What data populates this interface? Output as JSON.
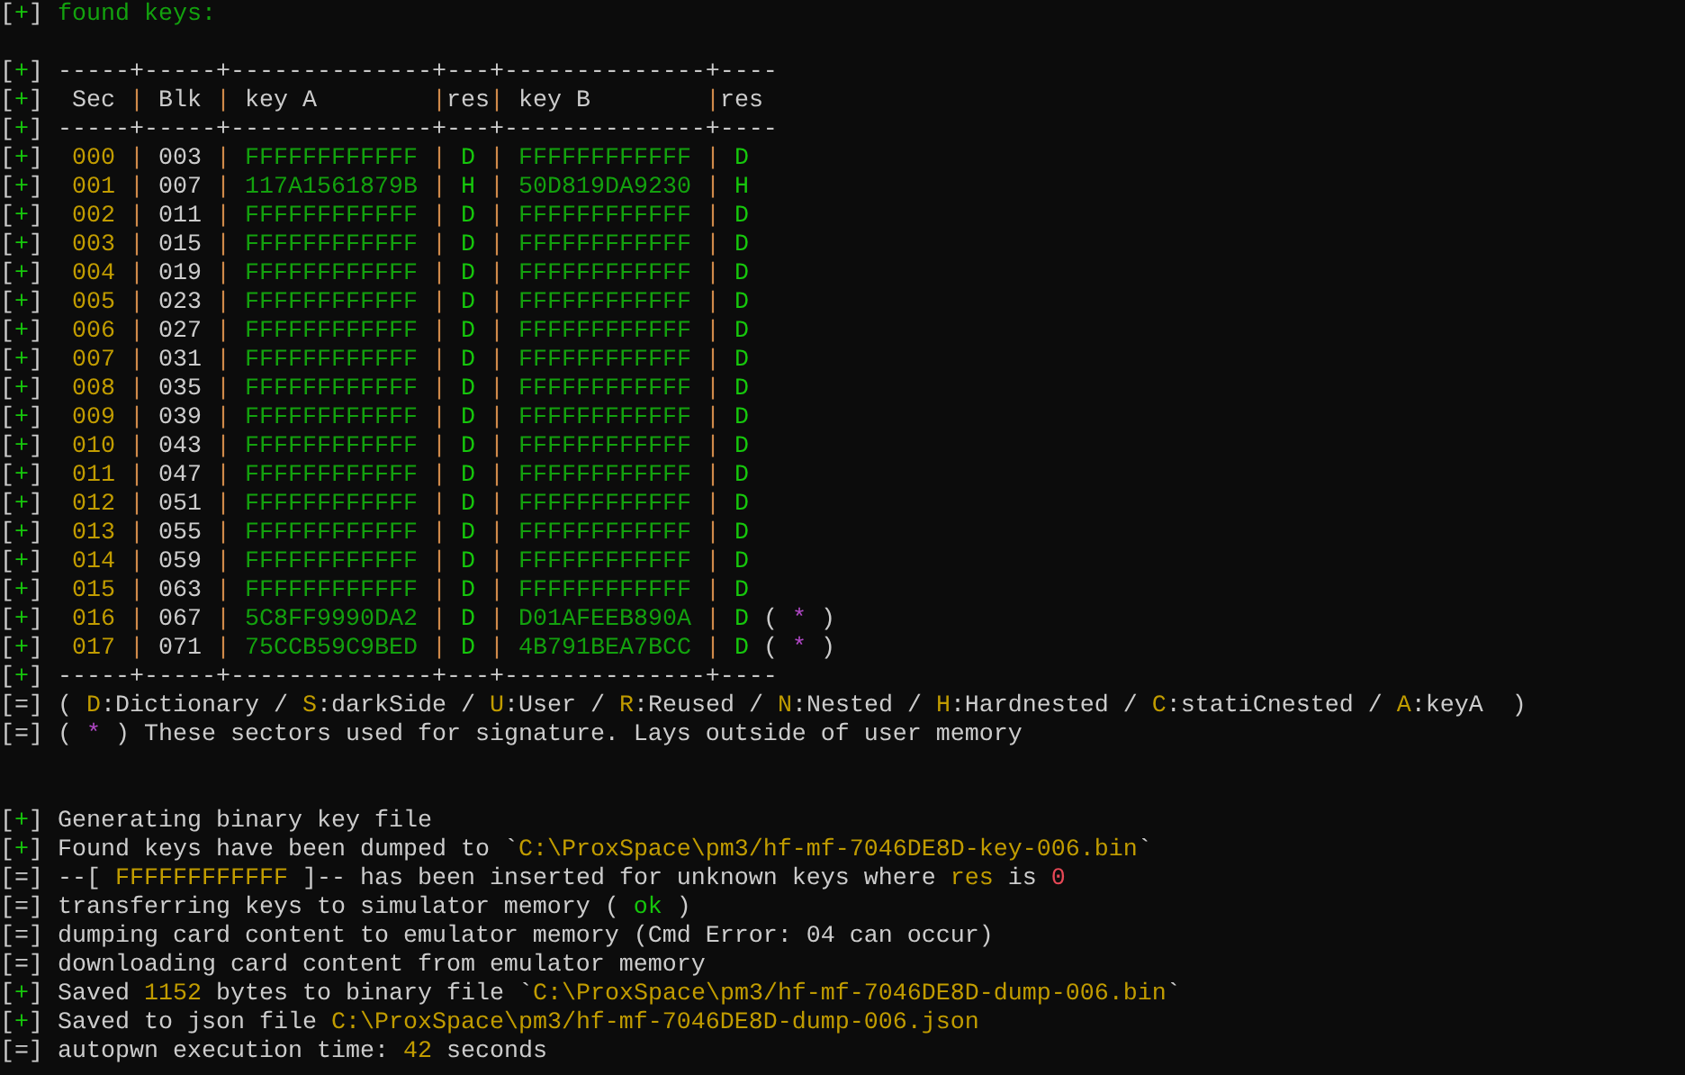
{
  "terminal": {
    "lines": [
      {
        "kind": "text",
        "segs": [
          {
            "text": "[",
            "kind": "plain"
          },
          {
            "text": "+",
            "kind": "ok"
          },
          {
            "text": "] ",
            "kind": "plain"
          },
          {
            "text": "found keys:",
            "kind": "key"
          }
        ]
      },
      {
        "kind": "blank"
      },
      {
        "kind": "text",
        "segs": [
          {
            "text": "[",
            "kind": "plain"
          },
          {
            "text": "+",
            "kind": "ok"
          },
          {
            "text": "] ",
            "kind": "plain"
          },
          {
            "text": "-----+-----+--------------+---+--------------+----",
            "kind": "plain"
          }
        ]
      },
      {
        "kind": "text",
        "segs": [
          {
            "text": "[",
            "kind": "plain"
          },
          {
            "text": "+",
            "kind": "ok"
          },
          {
            "text": "] ",
            "kind": "plain"
          },
          {
            "text": " Sec",
            "kind": "plain"
          },
          {
            "text": " | ",
            "kind": "sep"
          },
          {
            "text": "Blk",
            "kind": "plain"
          },
          {
            "text": " | ",
            "kind": "sep"
          },
          {
            "text": "key A",
            "kind": "plain"
          },
          {
            "text": "        |",
            "kind": "sep"
          },
          {
            "text": "res",
            "kind": "plain"
          },
          {
            "text": "| ",
            "kind": "sep"
          },
          {
            "text": "key B",
            "kind": "plain"
          },
          {
            "text": "        |",
            "kind": "sep"
          },
          {
            "text": "res",
            "kind": "plain"
          }
        ]
      },
      {
        "kind": "text",
        "segs": [
          {
            "text": "[",
            "kind": "plain"
          },
          {
            "text": "+",
            "kind": "ok"
          },
          {
            "text": "] ",
            "kind": "plain"
          },
          {
            "text": "-----+-----+--------------+---+--------------+----",
            "kind": "plain"
          }
        ]
      },
      {
        "kind": "text",
        "segs": [
          {
            "text": "[",
            "kind": "plain"
          },
          {
            "text": "+",
            "kind": "ok"
          },
          {
            "text": "] ",
            "kind": "plain"
          },
          {
            "text": " 000",
            "kind": "hi"
          },
          {
            "text": " | ",
            "kind": "sep"
          },
          {
            "text": "003",
            "kind": "plain"
          },
          {
            "text": " | ",
            "kind": "sep"
          },
          {
            "text": "FFFFFFFFFFFF",
            "kind": "key"
          },
          {
            "text": " | ",
            "kind": "sep"
          },
          {
            "text": "D",
            "kind": "ok"
          },
          {
            "text": " | ",
            "kind": "sep"
          },
          {
            "text": "FFFFFFFFFFFF",
            "kind": "key"
          },
          {
            "text": " | ",
            "kind": "sep"
          },
          {
            "text": "D",
            "kind": "ok"
          }
        ]
      },
      {
        "kind": "text",
        "segs": [
          {
            "text": "[",
            "kind": "plain"
          },
          {
            "text": "+",
            "kind": "ok"
          },
          {
            "text": "] ",
            "kind": "plain"
          },
          {
            "text": " 001",
            "kind": "hi"
          },
          {
            "text": " | ",
            "kind": "sep"
          },
          {
            "text": "007",
            "kind": "plain"
          },
          {
            "text": " | ",
            "kind": "sep"
          },
          {
            "text": "117A1561879B",
            "kind": "key"
          },
          {
            "text": " | ",
            "kind": "sep"
          },
          {
            "text": "H",
            "kind": "ok"
          },
          {
            "text": " | ",
            "kind": "sep"
          },
          {
            "text": "50D819DA9230",
            "kind": "key"
          },
          {
            "text": " | ",
            "kind": "sep"
          },
          {
            "text": "H",
            "kind": "ok"
          }
        ]
      },
      {
        "kind": "text",
        "segs": [
          {
            "text": "[",
            "kind": "plain"
          },
          {
            "text": "+",
            "kind": "ok"
          },
          {
            "text": "] ",
            "kind": "plain"
          },
          {
            "text": " 002",
            "kind": "hi"
          },
          {
            "text": " | ",
            "kind": "sep"
          },
          {
            "text": "011",
            "kind": "plain"
          },
          {
            "text": " | ",
            "kind": "sep"
          },
          {
            "text": "FFFFFFFFFFFF",
            "kind": "key"
          },
          {
            "text": " | ",
            "kind": "sep"
          },
          {
            "text": "D",
            "kind": "ok"
          },
          {
            "text": " | ",
            "kind": "sep"
          },
          {
            "text": "FFFFFFFFFFFF",
            "kind": "key"
          },
          {
            "text": " | ",
            "kind": "sep"
          },
          {
            "text": "D",
            "kind": "ok"
          }
        ]
      },
      {
        "kind": "text",
        "segs": [
          {
            "text": "[",
            "kind": "plain"
          },
          {
            "text": "+",
            "kind": "ok"
          },
          {
            "text": "] ",
            "kind": "plain"
          },
          {
            "text": " 003",
            "kind": "hi"
          },
          {
            "text": " | ",
            "kind": "sep"
          },
          {
            "text": "015",
            "kind": "plain"
          },
          {
            "text": " | ",
            "kind": "sep"
          },
          {
            "text": "FFFFFFFFFFFF",
            "kind": "key"
          },
          {
            "text": " | ",
            "kind": "sep"
          },
          {
            "text": "D",
            "kind": "ok"
          },
          {
            "text": " | ",
            "kind": "sep"
          },
          {
            "text": "FFFFFFFFFFFF",
            "kind": "key"
          },
          {
            "text": " | ",
            "kind": "sep"
          },
          {
            "text": "D",
            "kind": "ok"
          }
        ]
      },
      {
        "kind": "text",
        "segs": [
          {
            "text": "[",
            "kind": "plain"
          },
          {
            "text": "+",
            "kind": "ok"
          },
          {
            "text": "] ",
            "kind": "plain"
          },
          {
            "text": " 004",
            "kind": "hi"
          },
          {
            "text": " | ",
            "kind": "sep"
          },
          {
            "text": "019",
            "kind": "plain"
          },
          {
            "text": " | ",
            "kind": "sep"
          },
          {
            "text": "FFFFFFFFFFFF",
            "kind": "key"
          },
          {
            "text": " | ",
            "kind": "sep"
          },
          {
            "text": "D",
            "kind": "ok"
          },
          {
            "text": " | ",
            "kind": "sep"
          },
          {
            "text": "FFFFFFFFFFFF",
            "kind": "key"
          },
          {
            "text": " | ",
            "kind": "sep"
          },
          {
            "text": "D",
            "kind": "ok"
          }
        ]
      },
      {
        "kind": "text",
        "segs": [
          {
            "text": "[",
            "kind": "plain"
          },
          {
            "text": "+",
            "kind": "ok"
          },
          {
            "text": "] ",
            "kind": "plain"
          },
          {
            "text": " 005",
            "kind": "hi"
          },
          {
            "text": " | ",
            "kind": "sep"
          },
          {
            "text": "023",
            "kind": "plain"
          },
          {
            "text": " | ",
            "kind": "sep"
          },
          {
            "text": "FFFFFFFFFFFF",
            "kind": "key"
          },
          {
            "text": " | ",
            "kind": "sep"
          },
          {
            "text": "D",
            "kind": "ok"
          },
          {
            "text": " | ",
            "kind": "sep"
          },
          {
            "text": "FFFFFFFFFFFF",
            "kind": "key"
          },
          {
            "text": " | ",
            "kind": "sep"
          },
          {
            "text": "D",
            "kind": "ok"
          }
        ]
      },
      {
        "kind": "text",
        "segs": [
          {
            "text": "[",
            "kind": "plain"
          },
          {
            "text": "+",
            "kind": "ok"
          },
          {
            "text": "] ",
            "kind": "plain"
          },
          {
            "text": " 006",
            "kind": "hi"
          },
          {
            "text": " | ",
            "kind": "sep"
          },
          {
            "text": "027",
            "kind": "plain"
          },
          {
            "text": " | ",
            "kind": "sep"
          },
          {
            "text": "FFFFFFFFFFFF",
            "kind": "key"
          },
          {
            "text": " | ",
            "kind": "sep"
          },
          {
            "text": "D",
            "kind": "ok"
          },
          {
            "text": " | ",
            "kind": "sep"
          },
          {
            "text": "FFFFFFFFFFFF",
            "kind": "key"
          },
          {
            "text": " | ",
            "kind": "sep"
          },
          {
            "text": "D",
            "kind": "ok"
          }
        ]
      },
      {
        "kind": "text",
        "segs": [
          {
            "text": "[",
            "kind": "plain"
          },
          {
            "text": "+",
            "kind": "ok"
          },
          {
            "text": "] ",
            "kind": "plain"
          },
          {
            "text": " 007",
            "kind": "hi"
          },
          {
            "text": " | ",
            "kind": "sep"
          },
          {
            "text": "031",
            "kind": "plain"
          },
          {
            "text": " | ",
            "kind": "sep"
          },
          {
            "text": "FFFFFFFFFFFF",
            "kind": "key"
          },
          {
            "text": " | ",
            "kind": "sep"
          },
          {
            "text": "D",
            "kind": "ok"
          },
          {
            "text": " | ",
            "kind": "sep"
          },
          {
            "text": "FFFFFFFFFFFF",
            "kind": "key"
          },
          {
            "text": " | ",
            "kind": "sep"
          },
          {
            "text": "D",
            "kind": "ok"
          }
        ]
      },
      {
        "kind": "text",
        "segs": [
          {
            "text": "[",
            "kind": "plain"
          },
          {
            "text": "+",
            "kind": "ok"
          },
          {
            "text": "] ",
            "kind": "plain"
          },
          {
            "text": " 008",
            "kind": "hi"
          },
          {
            "text": " | ",
            "kind": "sep"
          },
          {
            "text": "035",
            "kind": "plain"
          },
          {
            "text": " | ",
            "kind": "sep"
          },
          {
            "text": "FFFFFFFFFFFF",
            "kind": "key"
          },
          {
            "text": " | ",
            "kind": "sep"
          },
          {
            "text": "D",
            "kind": "ok"
          },
          {
            "text": " | ",
            "kind": "sep"
          },
          {
            "text": "FFFFFFFFFFFF",
            "kind": "key"
          },
          {
            "text": " | ",
            "kind": "sep"
          },
          {
            "text": "D",
            "kind": "ok"
          }
        ]
      },
      {
        "kind": "text",
        "segs": [
          {
            "text": "[",
            "kind": "plain"
          },
          {
            "text": "+",
            "kind": "ok"
          },
          {
            "text": "] ",
            "kind": "plain"
          },
          {
            "text": " 009",
            "kind": "hi"
          },
          {
            "text": " | ",
            "kind": "sep"
          },
          {
            "text": "039",
            "kind": "plain"
          },
          {
            "text": " | ",
            "kind": "sep"
          },
          {
            "text": "FFFFFFFFFFFF",
            "kind": "key"
          },
          {
            "text": " | ",
            "kind": "sep"
          },
          {
            "text": "D",
            "kind": "ok"
          },
          {
            "text": " | ",
            "kind": "sep"
          },
          {
            "text": "FFFFFFFFFFFF",
            "kind": "key"
          },
          {
            "text": " | ",
            "kind": "sep"
          },
          {
            "text": "D",
            "kind": "ok"
          }
        ]
      },
      {
        "kind": "text",
        "segs": [
          {
            "text": "[",
            "kind": "plain"
          },
          {
            "text": "+",
            "kind": "ok"
          },
          {
            "text": "] ",
            "kind": "plain"
          },
          {
            "text": " 010",
            "kind": "hi"
          },
          {
            "text": " | ",
            "kind": "sep"
          },
          {
            "text": "043",
            "kind": "plain"
          },
          {
            "text": " | ",
            "kind": "sep"
          },
          {
            "text": "FFFFFFFFFFFF",
            "kind": "key"
          },
          {
            "text": " | ",
            "kind": "sep"
          },
          {
            "text": "D",
            "kind": "ok"
          },
          {
            "text": " | ",
            "kind": "sep"
          },
          {
            "text": "FFFFFFFFFFFF",
            "kind": "key"
          },
          {
            "text": " | ",
            "kind": "sep"
          },
          {
            "text": "D",
            "kind": "ok"
          }
        ]
      },
      {
        "kind": "text",
        "segs": [
          {
            "text": "[",
            "kind": "plain"
          },
          {
            "text": "+",
            "kind": "ok"
          },
          {
            "text": "] ",
            "kind": "plain"
          },
          {
            "text": " 011",
            "kind": "hi"
          },
          {
            "text": " | ",
            "kind": "sep"
          },
          {
            "text": "047",
            "kind": "plain"
          },
          {
            "text": " | ",
            "kind": "sep"
          },
          {
            "text": "FFFFFFFFFFFF",
            "kind": "key"
          },
          {
            "text": " | ",
            "kind": "sep"
          },
          {
            "text": "D",
            "kind": "ok"
          },
          {
            "text": " | ",
            "kind": "sep"
          },
          {
            "text": "FFFFFFFFFFFF",
            "kind": "key"
          },
          {
            "text": " | ",
            "kind": "sep"
          },
          {
            "text": "D",
            "kind": "ok"
          }
        ]
      },
      {
        "kind": "text",
        "segs": [
          {
            "text": "[",
            "kind": "plain"
          },
          {
            "text": "+",
            "kind": "ok"
          },
          {
            "text": "] ",
            "kind": "plain"
          },
          {
            "text": " 012",
            "kind": "hi"
          },
          {
            "text": " | ",
            "kind": "sep"
          },
          {
            "text": "051",
            "kind": "plain"
          },
          {
            "text": " | ",
            "kind": "sep"
          },
          {
            "text": "FFFFFFFFFFFF",
            "kind": "key"
          },
          {
            "text": " | ",
            "kind": "sep"
          },
          {
            "text": "D",
            "kind": "ok"
          },
          {
            "text": " | ",
            "kind": "sep"
          },
          {
            "text": "FFFFFFFFFFFF",
            "kind": "key"
          },
          {
            "text": " | ",
            "kind": "sep"
          },
          {
            "text": "D",
            "kind": "ok"
          }
        ]
      },
      {
        "kind": "text",
        "segs": [
          {
            "text": "[",
            "kind": "plain"
          },
          {
            "text": "+",
            "kind": "ok"
          },
          {
            "text": "] ",
            "kind": "plain"
          },
          {
            "text": " 013",
            "kind": "hi"
          },
          {
            "text": " | ",
            "kind": "sep"
          },
          {
            "text": "055",
            "kind": "plain"
          },
          {
            "text": " | ",
            "kind": "sep"
          },
          {
            "text": "FFFFFFFFFFFF",
            "kind": "key"
          },
          {
            "text": " | ",
            "kind": "sep"
          },
          {
            "text": "D",
            "kind": "ok"
          },
          {
            "text": " | ",
            "kind": "sep"
          },
          {
            "text": "FFFFFFFFFFFF",
            "kind": "key"
          },
          {
            "text": " | ",
            "kind": "sep"
          },
          {
            "text": "D",
            "kind": "ok"
          }
        ]
      },
      {
        "kind": "text",
        "segs": [
          {
            "text": "[",
            "kind": "plain"
          },
          {
            "text": "+",
            "kind": "ok"
          },
          {
            "text": "] ",
            "kind": "plain"
          },
          {
            "text": " 014",
            "kind": "hi"
          },
          {
            "text": " | ",
            "kind": "sep"
          },
          {
            "text": "059",
            "kind": "plain"
          },
          {
            "text": " | ",
            "kind": "sep"
          },
          {
            "text": "FFFFFFFFFFFF",
            "kind": "key"
          },
          {
            "text": " | ",
            "kind": "sep"
          },
          {
            "text": "D",
            "kind": "ok"
          },
          {
            "text": " | ",
            "kind": "sep"
          },
          {
            "text": "FFFFFFFFFFFF",
            "kind": "key"
          },
          {
            "text": " | ",
            "kind": "sep"
          },
          {
            "text": "D",
            "kind": "ok"
          }
        ]
      },
      {
        "kind": "text",
        "segs": [
          {
            "text": "[",
            "kind": "plain"
          },
          {
            "text": "+",
            "kind": "ok"
          },
          {
            "text": "] ",
            "kind": "plain"
          },
          {
            "text": " 015",
            "kind": "hi"
          },
          {
            "text": " | ",
            "kind": "sep"
          },
          {
            "text": "063",
            "kind": "plain"
          },
          {
            "text": " | ",
            "kind": "sep"
          },
          {
            "text": "FFFFFFFFFFFF",
            "kind": "key"
          },
          {
            "text": " | ",
            "kind": "sep"
          },
          {
            "text": "D",
            "kind": "ok"
          },
          {
            "text": " | ",
            "kind": "sep"
          },
          {
            "text": "FFFFFFFFFFFF",
            "kind": "key"
          },
          {
            "text": " | ",
            "kind": "sep"
          },
          {
            "text": "D",
            "kind": "ok"
          }
        ]
      },
      {
        "kind": "text",
        "segs": [
          {
            "text": "[",
            "kind": "plain"
          },
          {
            "text": "+",
            "kind": "ok"
          },
          {
            "text": "] ",
            "kind": "plain"
          },
          {
            "text": " 016",
            "kind": "hi"
          },
          {
            "text": " | ",
            "kind": "sep"
          },
          {
            "text": "067",
            "kind": "plain"
          },
          {
            "text": " | ",
            "kind": "sep"
          },
          {
            "text": "5C8FF9990DA2",
            "kind": "key"
          },
          {
            "text": " | ",
            "kind": "sep"
          },
          {
            "text": "D",
            "kind": "ok"
          },
          {
            "text": " | ",
            "kind": "sep"
          },
          {
            "text": "D01AFEEB890A",
            "kind": "key"
          },
          {
            "text": " | ",
            "kind": "sep"
          },
          {
            "text": "D",
            "kind": "ok"
          },
          {
            "text": " ( ",
            "kind": "plain"
          },
          {
            "text": "*",
            "kind": "star"
          },
          {
            "text": " )",
            "kind": "plain"
          }
        ]
      },
      {
        "kind": "text",
        "segs": [
          {
            "text": "[",
            "kind": "plain"
          },
          {
            "text": "+",
            "kind": "ok"
          },
          {
            "text": "] ",
            "kind": "plain"
          },
          {
            "text": " 017",
            "kind": "hi"
          },
          {
            "text": " | ",
            "kind": "sep"
          },
          {
            "text": "071",
            "kind": "plain"
          },
          {
            "text": " | ",
            "kind": "sep"
          },
          {
            "text": "75CCB59C9BED",
            "kind": "key"
          },
          {
            "text": " | ",
            "kind": "sep"
          },
          {
            "text": "D",
            "kind": "ok"
          },
          {
            "text": " | ",
            "kind": "sep"
          },
          {
            "text": "4B791BEA7BCC",
            "kind": "key"
          },
          {
            "text": " | ",
            "kind": "sep"
          },
          {
            "text": "D",
            "kind": "ok"
          },
          {
            "text": " ( ",
            "kind": "plain"
          },
          {
            "text": "*",
            "kind": "star"
          },
          {
            "text": " )",
            "kind": "plain"
          }
        ]
      },
      {
        "kind": "text",
        "segs": [
          {
            "text": "[",
            "kind": "plain"
          },
          {
            "text": "+",
            "kind": "ok"
          },
          {
            "text": "] ",
            "kind": "plain"
          },
          {
            "text": "-----+-----+--------------+---+--------------+----",
            "kind": "plain"
          }
        ]
      },
      {
        "kind": "text",
        "segs": [
          {
            "text": "[=] ( ",
            "kind": "plain"
          },
          {
            "text": "D",
            "kind": "hi"
          },
          {
            "text": ":Dictionary / ",
            "kind": "plain"
          },
          {
            "text": "S",
            "kind": "hi"
          },
          {
            "text": ":darkSide / ",
            "kind": "plain"
          },
          {
            "text": "U",
            "kind": "hi"
          },
          {
            "text": ":User / ",
            "kind": "plain"
          },
          {
            "text": "R",
            "kind": "hi"
          },
          {
            "text": ":Reused / ",
            "kind": "plain"
          },
          {
            "text": "N",
            "kind": "hi"
          },
          {
            "text": ":Nested / ",
            "kind": "plain"
          },
          {
            "text": "H",
            "kind": "hi"
          },
          {
            "text": ":Hardnested / ",
            "kind": "plain"
          },
          {
            "text": "C",
            "kind": "hi"
          },
          {
            "text": ":statiCnested / ",
            "kind": "plain"
          },
          {
            "text": "A",
            "kind": "hi"
          },
          {
            "text": ":keyA  )",
            "kind": "plain"
          }
        ]
      },
      {
        "kind": "text",
        "segs": [
          {
            "text": "[=] ( ",
            "kind": "plain"
          },
          {
            "text": "*",
            "kind": "star"
          },
          {
            "text": " ) These sectors used for signature. Lays outside of user memory",
            "kind": "plain"
          }
        ]
      },
      {
        "kind": "blank"
      },
      {
        "kind": "blank"
      },
      {
        "kind": "text",
        "segs": [
          {
            "text": "[",
            "kind": "plain"
          },
          {
            "text": "+",
            "kind": "ok"
          },
          {
            "text": "] Generating binary key file",
            "kind": "plain"
          }
        ]
      },
      {
        "kind": "text",
        "segs": [
          {
            "text": "[",
            "kind": "plain"
          },
          {
            "text": "+",
            "kind": "ok"
          },
          {
            "text": "] Found keys have been dumped to `",
            "kind": "plain"
          },
          {
            "text": "C:\\ProxSpace\\pm3/hf-mf-7046DE8D-key-006.bin",
            "kind": "hi"
          },
          {
            "text": "`",
            "kind": "plain"
          }
        ]
      },
      {
        "kind": "text",
        "segs": [
          {
            "text": "[=] --[ ",
            "kind": "plain"
          },
          {
            "text": "FFFFFFFFFFFF",
            "kind": "hi"
          },
          {
            "text": " ]-- has been inserted for unknown keys where ",
            "kind": "plain"
          },
          {
            "text": "res",
            "kind": "hi"
          },
          {
            "text": " is ",
            "kind": "plain"
          },
          {
            "text": "0",
            "kind": "err"
          }
        ]
      },
      {
        "kind": "text",
        "segs": [
          {
            "text": "[=] transferring keys to simulator memory ( ",
            "kind": "plain"
          },
          {
            "text": "ok",
            "kind": "ok"
          },
          {
            "text": " )",
            "kind": "plain"
          }
        ]
      },
      {
        "kind": "text",
        "segs": [
          {
            "text": "[=] dumping card content to emulator memory (Cmd Error: 04 can occur)",
            "kind": "plain"
          }
        ]
      },
      {
        "kind": "text",
        "segs": [
          {
            "text": "[=] downloading card content from emulator memory",
            "kind": "plain"
          }
        ]
      },
      {
        "kind": "text",
        "segs": [
          {
            "text": "[",
            "kind": "plain"
          },
          {
            "text": "+",
            "kind": "ok"
          },
          {
            "text": "] Saved ",
            "kind": "plain"
          },
          {
            "text": "1152",
            "kind": "hi"
          },
          {
            "text": " bytes to binary file `",
            "kind": "plain"
          },
          {
            "text": "C:\\ProxSpace\\pm3/hf-mf-7046DE8D-dump-006.bin",
            "kind": "hi"
          },
          {
            "text": "`",
            "kind": "plain"
          }
        ]
      },
      {
        "kind": "text",
        "segs": [
          {
            "text": "[",
            "kind": "plain"
          },
          {
            "text": "+",
            "kind": "ok"
          },
          {
            "text": "] Saved to json file ",
            "kind": "plain"
          },
          {
            "text": "C:\\ProxSpace\\pm3/hf-mf-7046DE8D-dump-006.json",
            "kind": "hi"
          }
        ]
      },
      {
        "kind": "text",
        "segs": [
          {
            "text": "[=] autopwn execution time: ",
            "kind": "plain"
          },
          {
            "text": "42",
            "kind": "hi"
          },
          {
            "text": " seconds",
            "kind": "plain"
          }
        ]
      }
    ]
  }
}
